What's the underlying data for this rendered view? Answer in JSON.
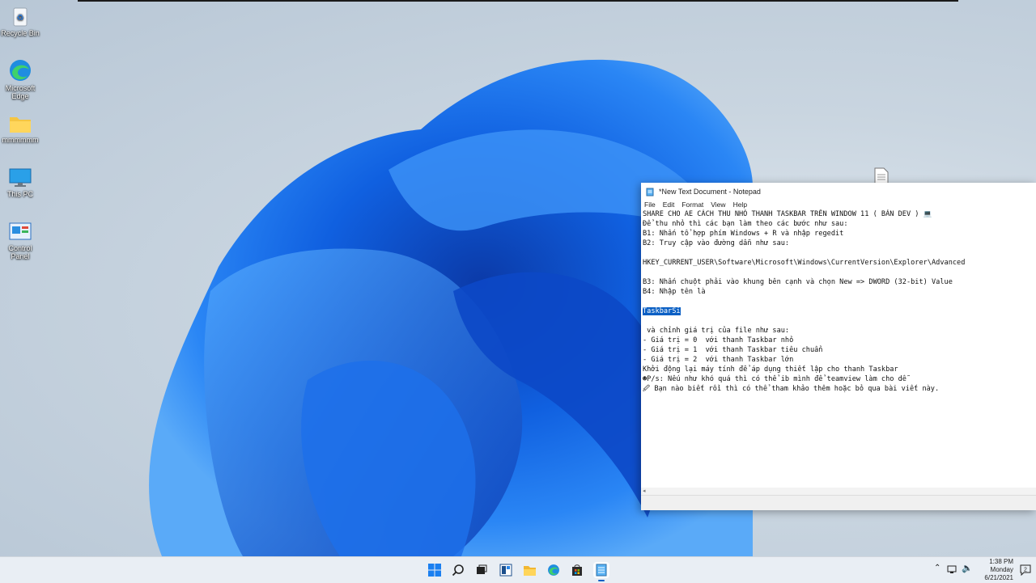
{
  "desktop": {
    "icons": [
      {
        "label": "Recycle Bin",
        "icon": "recycle-bin-icon"
      },
      {
        "label": "Microsoft Edge",
        "icon": "edge-icon"
      },
      {
        "label": "mmmmmm",
        "icon": "folder-icon"
      },
      {
        "label": "This PC",
        "icon": "monitor-icon"
      },
      {
        "label": "Control Panel",
        "icon": "control-panel-icon"
      }
    ]
  },
  "notepad": {
    "title": "*New Text Document - Notepad",
    "menu": [
      "File",
      "Edit",
      "Format",
      "View",
      "Help"
    ],
    "lines": [
      "SHARE CHO AE CÁCH THU NHỎ THANH TASKBAR TRÊN WINDOW 11 ( BẢN DEV ) 💻",
      "Để thu nhỏ thì các bạn làm theo các bước như sau:",
      "B1: Nhấn tổ hợp phím Windows + R và nhập regedit",
      "B2: Truy cập vào đường dẫn như sau:",
      "",
      "HKEY_CURRENT_USER\\Software\\Microsoft\\Windows\\CurrentVersion\\Explorer\\Advanced",
      "",
      "B3: Nhấn chuột phải vào khung bên cạnh và chọn New => DWORD (32-bit) Value",
      "B4: Nhập tên là",
      "",
      "TaskbarSi",
      "",
      " và chỉnh giá trị của file như sau:",
      "- Giá trị = 0  với thanh Taskbar nhỏ",
      "- Giá trị = 1  với thanh Taskbar tiêu chuẩn",
      "- Giá trị = 2  với thanh Taskbar lớn",
      "Khởi động lại máy tính để áp dụng thiết lập cho thanh Taskbar",
      "☻P/s: Nếu như khó quá thì có thể ib mình để teamview làm cho dễ",
      "🖉 Bạn nào biết rồi thì có thể tham khảo thêm hoặc bỏ qua bài viết này."
    ],
    "selected_line_index": 10
  },
  "taskbar": {
    "apps": [
      "start-icon",
      "search-icon",
      "task-view-icon",
      "widgets-icon",
      "file-explorer-icon",
      "edge-icon",
      "store-icon",
      "notepad-icon"
    ],
    "time": "1:38 PM",
    "day": "Monday",
    "date": "6/21/2021"
  },
  "colors": {
    "accent": "#0a5fc4",
    "bloom": "#1a6fe8"
  }
}
